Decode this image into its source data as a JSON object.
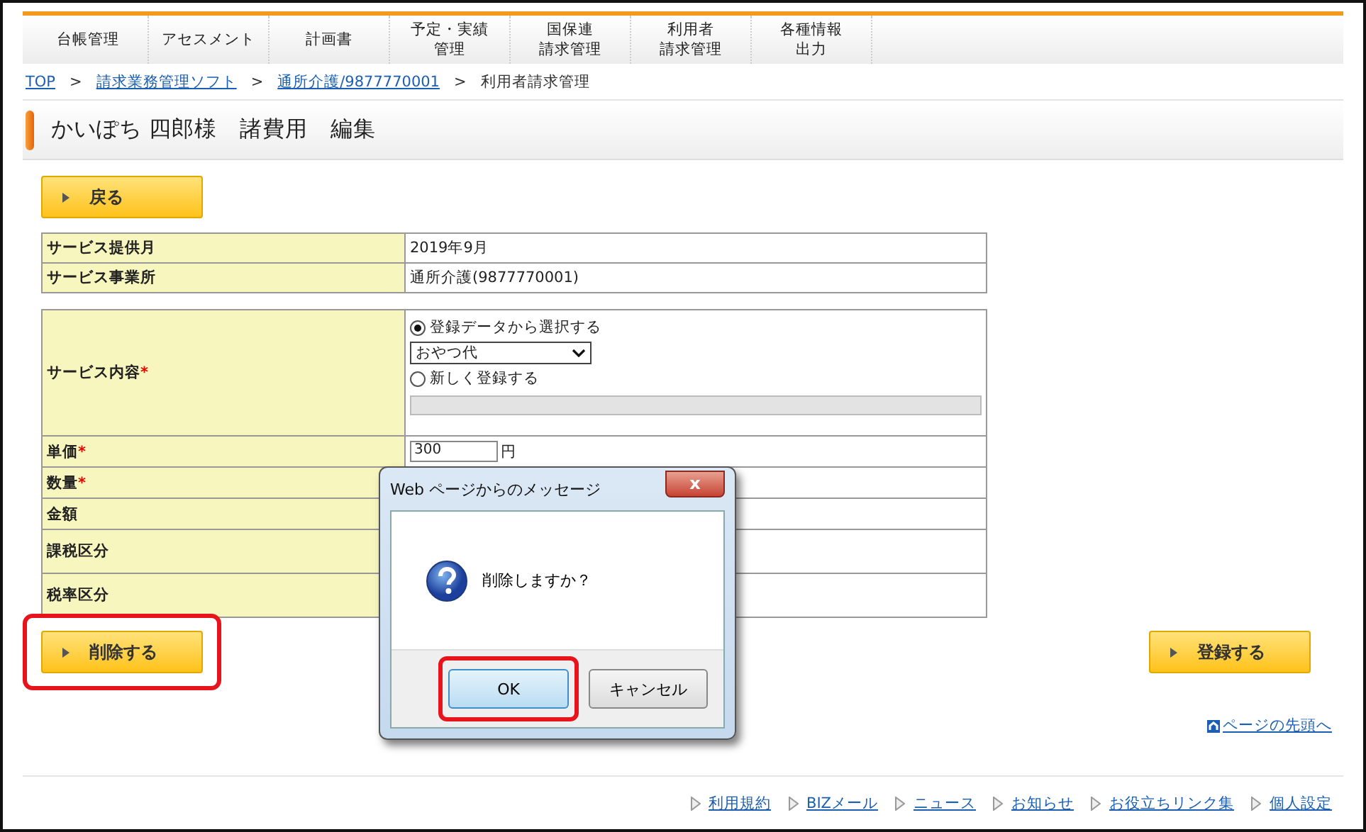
{
  "nav": {
    "tabs": [
      {
        "lines": [
          "台帳管理"
        ]
      },
      {
        "lines": [
          "アセスメント"
        ]
      },
      {
        "lines": [
          "計画書"
        ]
      },
      {
        "lines": [
          "予定・実績",
          "管理"
        ]
      },
      {
        "lines": [
          "国保連",
          "請求管理"
        ]
      },
      {
        "lines": [
          "利用者",
          "請求管理"
        ]
      },
      {
        "lines": [
          "各種情報",
          "出力"
        ]
      }
    ]
  },
  "breadcrumb_separator": ">",
  "breadcrumb": [
    {
      "label": "TOP",
      "link": true
    },
    {
      "label": "請求業務管理ソフト",
      "link": true
    },
    {
      "label": "通所介護/9877770001",
      "link": true
    },
    {
      "label": "利用者請求管理",
      "link": false
    }
  ],
  "page_title": "かいぽち 四郎様　諸費用　編集",
  "back_button": {
    "label": "戻る"
  },
  "info_table": [
    {
      "label": "サービス提供月",
      "value": "2019年9月"
    },
    {
      "label": "サービス事業所",
      "value": "通所介護(9877770001)"
    }
  ],
  "form": {
    "service": {
      "label": "サービス内容",
      "required_mark": "*",
      "options": [
        {
          "label": "登録データから選択する",
          "selected": true
        },
        {
          "label": "新しく登録する",
          "selected": false
        }
      ],
      "select_value": "おやつ代"
    },
    "rows": [
      {
        "label": "単価",
        "required_mark": "*",
        "value": "300",
        "unit": "円"
      },
      {
        "label": "数量",
        "required_mark": "*"
      },
      {
        "label": "金額"
      },
      {
        "label": "課税区分"
      },
      {
        "label": "税率区分"
      }
    ]
  },
  "delete_button": {
    "label": "削除する",
    "highlighted": true
  },
  "register_button": {
    "label": "登録する",
    "highlighted": false
  },
  "page_top_link": "ページの先頭へ",
  "footer_links": [
    "利用規約",
    "BIZメール",
    "ニュース",
    "お知らせ",
    "お役立ちリンク集",
    "個人設定"
  ],
  "dialog": {
    "title": "Web ページからのメッセージ",
    "close": "x",
    "message": "削除しますか？",
    "buttons": [
      {
        "label": "OK",
        "highlighted": true
      },
      {
        "label": "キャンセル",
        "highlighted": false
      }
    ]
  }
}
